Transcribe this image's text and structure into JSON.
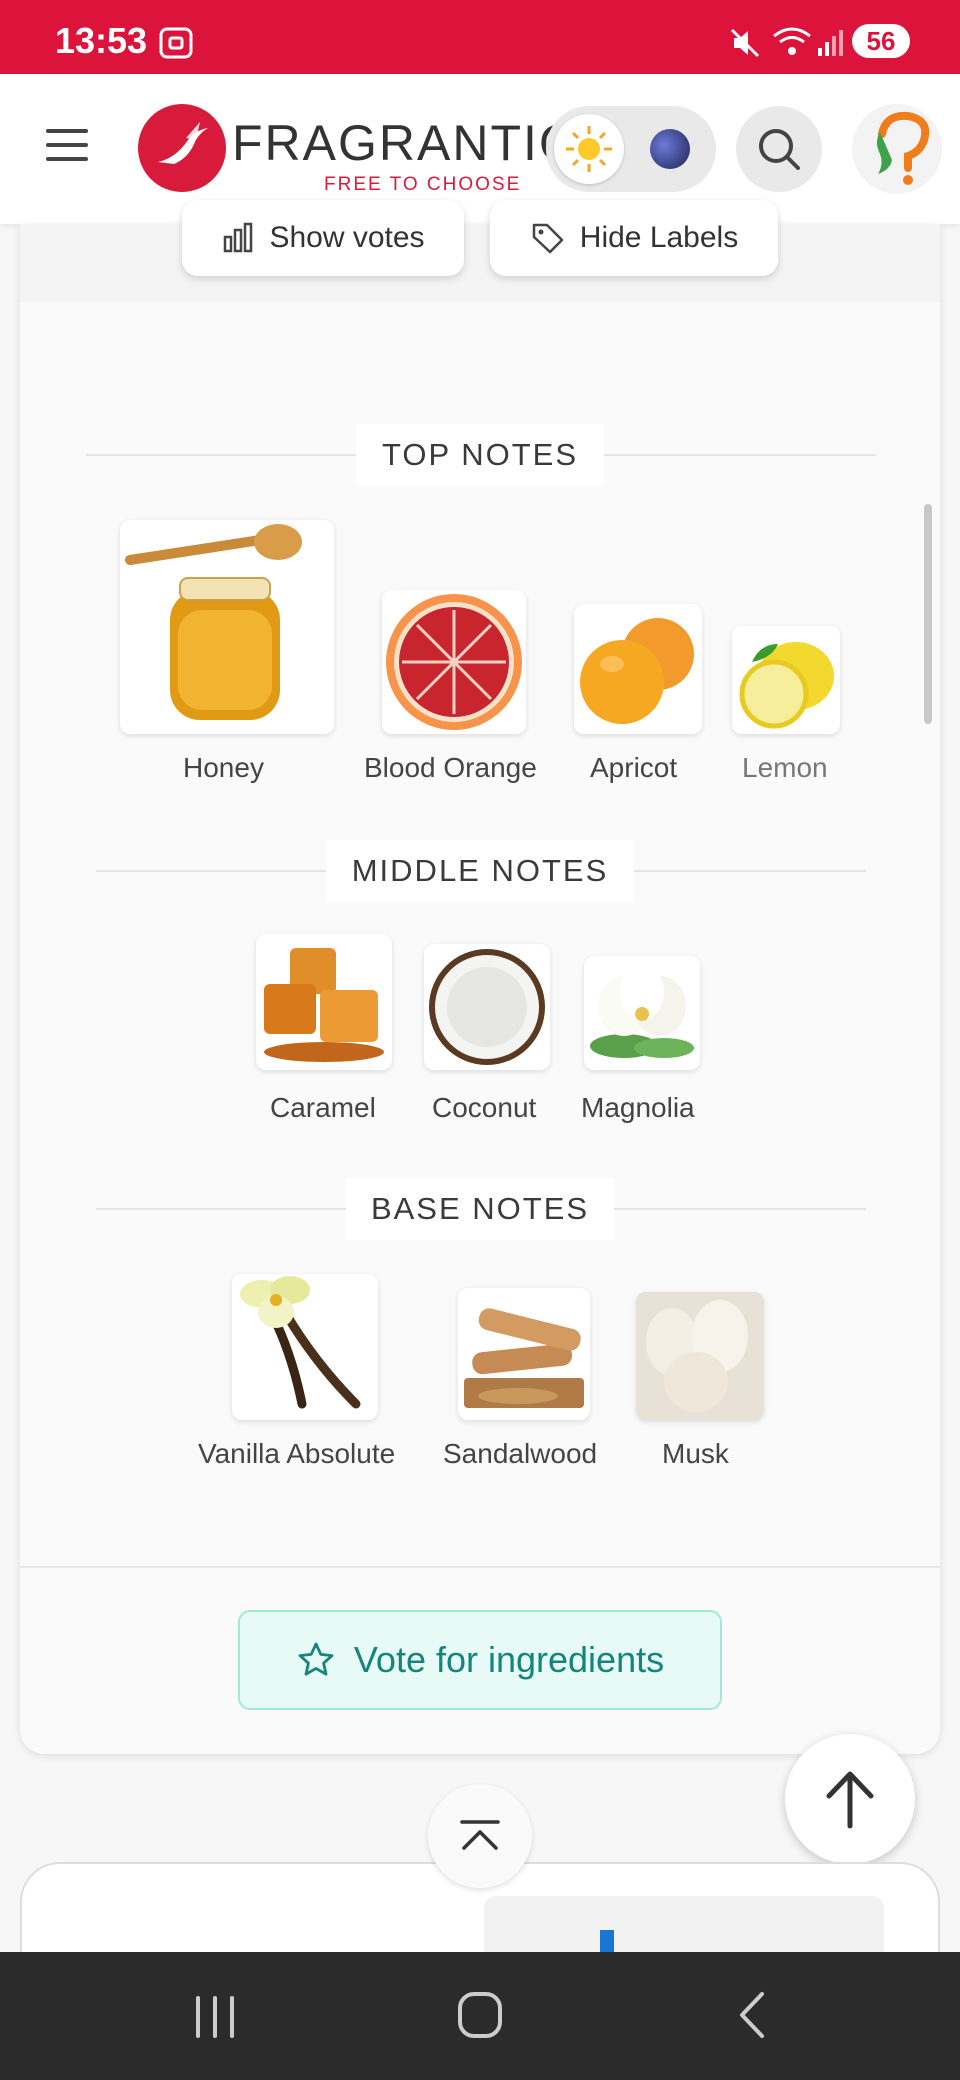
{
  "status_bar": {
    "time": "13:53",
    "battery": "56",
    "background_color": "#dc143c",
    "icons": [
      "screenshot-icon",
      "mute-icon",
      "wifi-icon",
      "signal-icon",
      "battery-icon"
    ]
  },
  "header": {
    "logo_text": "FRAGRANTICA",
    "tagline": "FREE TO CHOOSE",
    "brand_color": "#d81b3a"
  },
  "toolbar": {
    "show_votes_label": "Show votes",
    "hide_labels_label": "Hide Labels"
  },
  "pyramid": {
    "top": {
      "title": "TOP NOTES",
      "notes": [
        {
          "label": "Honey"
        },
        {
          "label": "Blood Orange"
        },
        {
          "label": "Apricot"
        },
        {
          "label": "Lemon"
        }
      ]
    },
    "middle": {
      "title": "MIDDLE NOTES",
      "notes": [
        {
          "label": "Caramel"
        },
        {
          "label": "Coconut"
        },
        {
          "label": "Magnolia"
        }
      ]
    },
    "base": {
      "title": "BASE NOTES",
      "notes": [
        {
          "label": "Vanilla Absolute"
        },
        {
          "label": "Sandalwood"
        },
        {
          "label": "Musk"
        }
      ]
    }
  },
  "actions": {
    "vote_ingredients_label": "Vote for ingredients",
    "accent_color": "#14857a"
  }
}
